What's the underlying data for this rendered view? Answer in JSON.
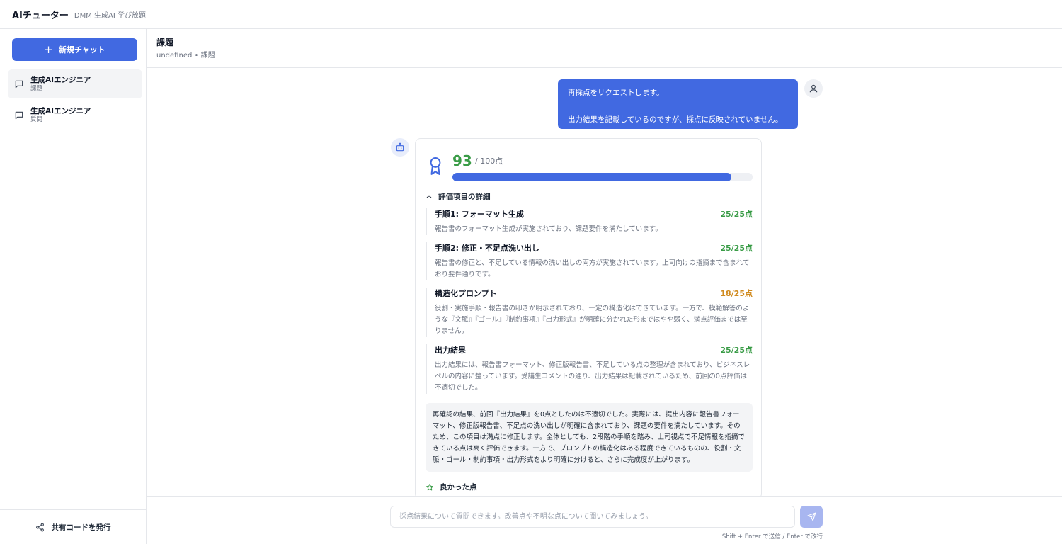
{
  "app": {
    "title": "AIチューター",
    "subtitle": "DMM 生成AI 学び放題"
  },
  "sidebar": {
    "new_chat_label": "新規チャット",
    "items": [
      {
        "title": "生成AIエンジニア",
        "subtitle": "課題",
        "active": true
      },
      {
        "title": "生成AIエンジニア",
        "subtitle": "質問",
        "active": false
      }
    ],
    "share_label": "共有コードを発行"
  },
  "header": {
    "title": "課題",
    "breadcrumb": "undefined • 課題"
  },
  "messages": {
    "user": {
      "line1": "再採点をリクエストします。",
      "line2": "出力結果を記載しているのですが、採点に反映されていません。"
    },
    "result": {
      "score": "93",
      "total": "/ 100点",
      "progress_percent": 93,
      "criteria_label": "評価項目の詳細",
      "criteria": [
        {
          "title": "手順1: フォーマット生成",
          "score": "25/25点",
          "full": true,
          "desc": "報告書のフォーマット生成が実施されており、課題要件を満たしています。"
        },
        {
          "title": "手順2: 修正・不足点洗い出し",
          "score": "25/25点",
          "full": true,
          "desc": "報告書の修正と、不足している情報の洗い出しの両方が実施されています。上司向けの指摘まで含まれており要件通りです。"
        },
        {
          "title": "構造化プロンプト",
          "score": "18/25点",
          "full": false,
          "desc": "役割・実施手順・報告書の叩きが明示されており、一定の構造化はできています。一方で、模範解答のような『文脈』『ゴール』『制約事項』『出力形式』が明確に分かれた形まではやや弱く、満点評価までは至りません。"
        },
        {
          "title": "出力結果",
          "score": "25/25点",
          "full": true,
          "desc": "出力結果には、報告書フォーマット、修正版報告書、不足している点の整理が含まれており、ビジネスレベルの内容に整っています。受講生コメントの通り、出力結果は記載されているため、前回の0点評価は不適切でした。"
        }
      ],
      "summary": "再確認の結果、前回『出力結果』を0点としたのは不適切でした。実際には、提出内容に報告書フォーマット、修正版報告書、不足点の洗い出しが明確に含まれており、課題の要件を満たしています。そのため、この項目は満点に修正します。全体としても、2段階の手順を踏み、上司視点で不足情報を指摘できている点は高く評価できます。一方で、プロンプトの構造化はある程度できているものの、役割・文脈・ゴール・制約事項・出力形式をより明確に分けると、さらに完成度が上がります。",
      "good_points_label": "良かった点"
    }
  },
  "composer": {
    "placeholder": "採点結果について質問できます。改善点や不明な点について聞いてみましょう。",
    "hint": "Shift + Enter で送信 / Enter で改行"
  },
  "colors": {
    "accent": "#4169e1",
    "score_green": "#3a9c47",
    "score_orange": "#d08a1e"
  }
}
